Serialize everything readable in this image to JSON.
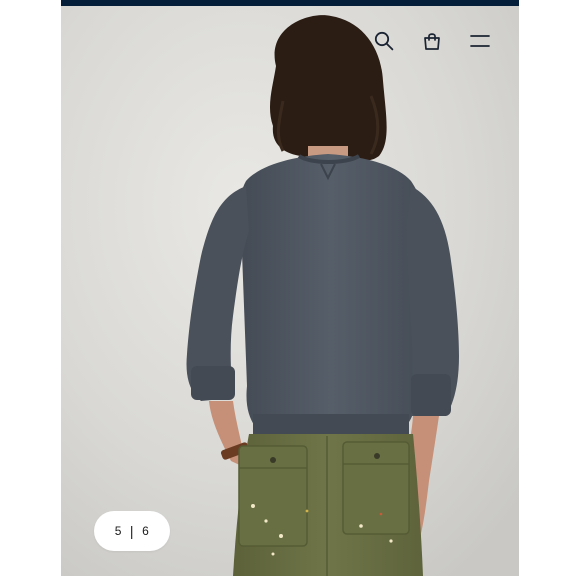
{
  "header": {
    "icons": [
      "search-icon",
      "shopping-bag-icon",
      "menu-icon"
    ]
  },
  "gallery": {
    "current": "5",
    "separator": "|",
    "total": "6",
    "image_subject": "man-back-view-grey-sweater"
  },
  "colors": {
    "topbar": "#041e3a",
    "background": "#dcdbd7",
    "sweater": "#4d5560",
    "pants": "#6b7144",
    "hair": "#2a1c14"
  }
}
